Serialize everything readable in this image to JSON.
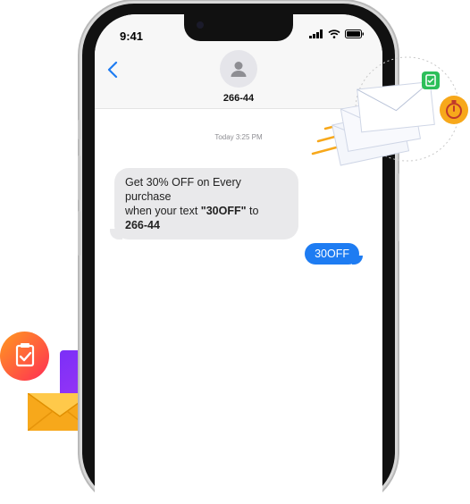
{
  "status": {
    "time": "9:41"
  },
  "header": {
    "contact": "266-44"
  },
  "thread": {
    "timestamp": "Today 3:25 PM",
    "incoming": {
      "line1": "Get 30% OFF on Every purchase",
      "line2_pre": "when your text ",
      "code": "\"30OFF\"",
      "line2_post": " to",
      "number": "266-44"
    },
    "outgoing": "30OFF"
  },
  "icons": {
    "back": "chevron-left-icon",
    "avatar": "person-icon",
    "signal": "signal-icon",
    "wifi": "wifi-icon",
    "battery": "battery-icon",
    "envelope": "envelope-icon",
    "stopwatch": "stopwatch-icon",
    "clipboard": "clipboard-check-icon",
    "chat": "chat-bubble-icon"
  },
  "colors": {
    "accent_blue": "#1e7cf2",
    "bubble_gray": "#e9e9eb",
    "purple": "#8a2be2",
    "orange": "#f7a81b",
    "red_orange": "#ff3b2f",
    "green_badge": "#2dbf5a"
  }
}
